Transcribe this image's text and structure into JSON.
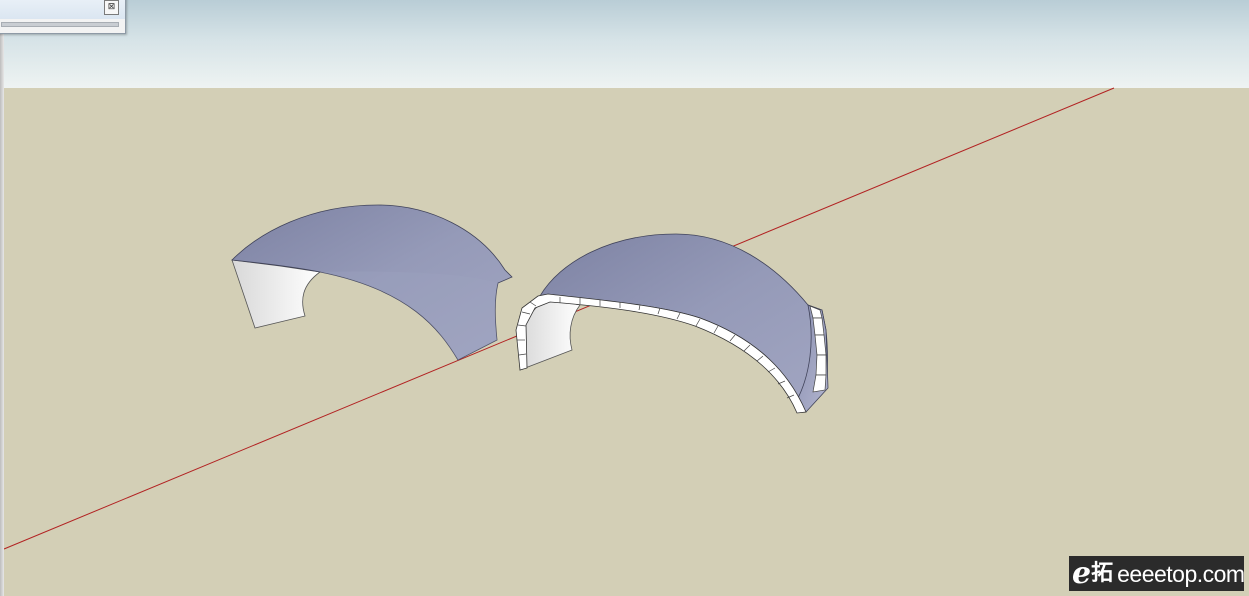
{
  "tool_window": {
    "close_glyph": "⊠"
  },
  "scene": {
    "ground_color": "#d3cfb6",
    "sky_color_top": "#b9cdd6",
    "sky_color_bottom": "#eef3f2",
    "axis_color": "#b22222",
    "shell_color": "#8e93b3",
    "edge_color": "#ffffff",
    "objects": [
      "shell-surface-left",
      "shell-solid-right"
    ]
  },
  "watermark": {
    "logo_letter": "e",
    "logo_char": "拓",
    "site": "eeeetop.com"
  }
}
